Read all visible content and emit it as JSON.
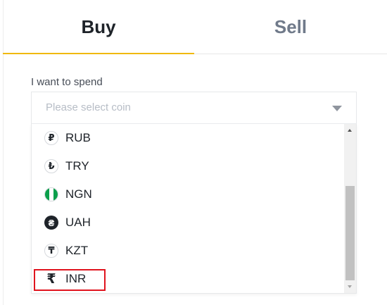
{
  "tabs": {
    "buy": "Buy",
    "sell": "Sell",
    "active": "Buy"
  },
  "form": {
    "spend_label": "I want to spend",
    "placeholder": "Please select coin"
  },
  "currencies": [
    {
      "code": "RUB",
      "icon": "ruble-icon",
      "glyph": "₽"
    },
    {
      "code": "TRY",
      "icon": "lira-icon",
      "glyph": "₺"
    },
    {
      "code": "NGN",
      "icon": "nigeria-flag-icon",
      "glyph": ""
    },
    {
      "code": "UAH",
      "icon": "hryvnia-icon",
      "glyph": "₴"
    },
    {
      "code": "KZT",
      "icon": "tenge-icon",
      "glyph": "₸"
    },
    {
      "code": "INR",
      "icon": "rupee-icon",
      "glyph": "₹"
    }
  ],
  "highlighted": "INR",
  "colors": {
    "accent": "#f0b90b",
    "highlight_border": "#e0141e",
    "text_primary": "#1e2329",
    "text_secondary": "#707a8a"
  }
}
